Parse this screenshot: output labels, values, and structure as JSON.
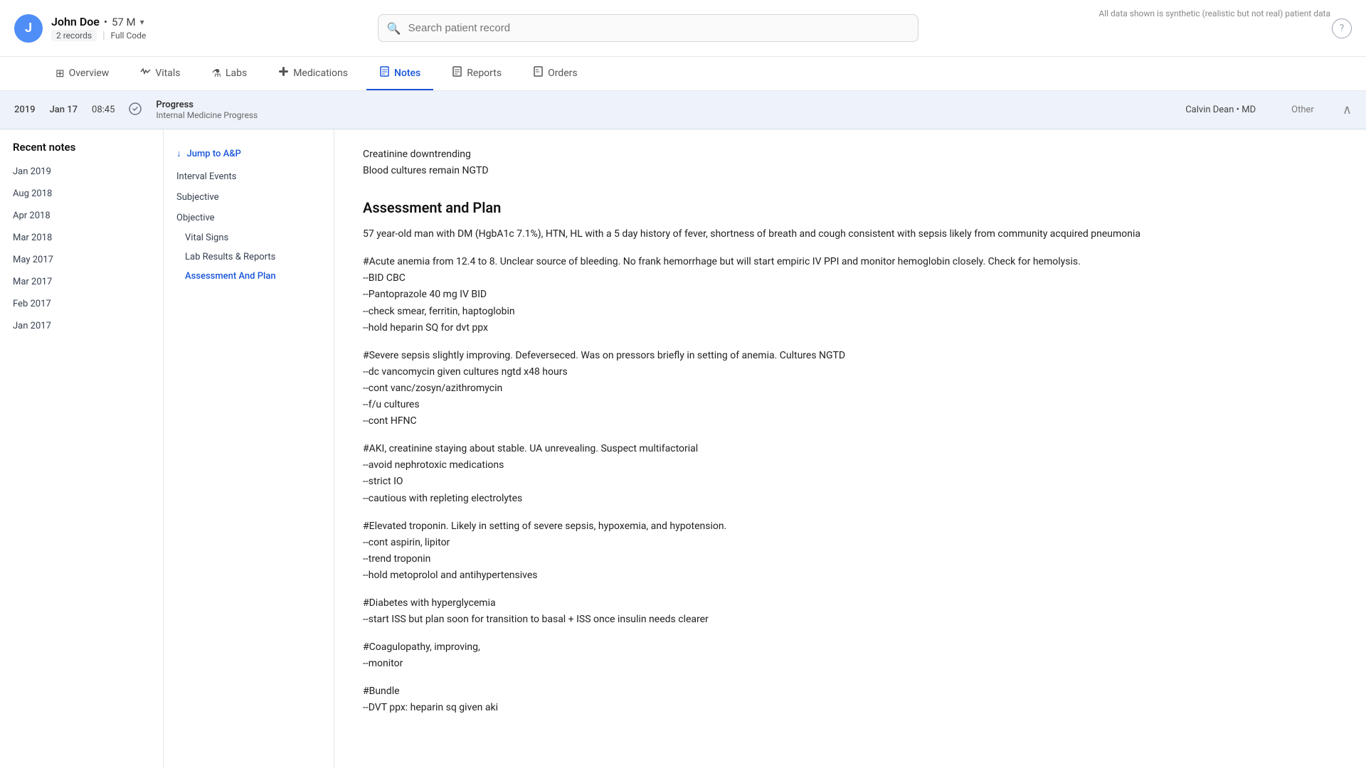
{
  "synthetic_note": "All data shown is synthetic (realistic but not real) patient data",
  "patient": {
    "name": "John Doe",
    "age_gender": "57 M",
    "records_count": "2 records",
    "code_status": "Full Code"
  },
  "search": {
    "placeholder": "Search patient record"
  },
  "nav_tabs": [
    {
      "id": "overview",
      "label": "Overview",
      "icon": "⊞"
    },
    {
      "id": "vitals",
      "label": "Vitals",
      "icon": "♥"
    },
    {
      "id": "labs",
      "label": "Labs",
      "icon": "⚗"
    },
    {
      "id": "medications",
      "label": "Medications",
      "icon": "💊"
    },
    {
      "id": "notes",
      "label": "Notes",
      "icon": "📝",
      "active": true
    },
    {
      "id": "reports",
      "label": "Reports",
      "icon": "📄"
    },
    {
      "id": "orders",
      "label": "Orders",
      "icon": "📋"
    }
  ],
  "note_header": {
    "year": "2019",
    "date": "Jan 17",
    "time": "08:45",
    "type": "Progress",
    "subtype": "Internal Medicine Progress",
    "doctor": "Calvin Dean • MD",
    "other": "Other"
  },
  "sidebar": {
    "title": "Recent notes",
    "items": [
      {
        "label": "Jan 2019"
      },
      {
        "label": "Aug 2018"
      },
      {
        "label": "Apr 2018"
      },
      {
        "label": "Mar 2018"
      },
      {
        "label": "May 2017"
      },
      {
        "label": "Mar 2017"
      },
      {
        "label": "Feb 2017"
      },
      {
        "label": "Jan 2017"
      }
    ]
  },
  "outline": {
    "jump_label": "Jump to A&P",
    "sections": [
      {
        "label": "Interval Events",
        "type": "section"
      },
      {
        "label": "Subjective",
        "type": "section"
      },
      {
        "label": "Objective",
        "type": "section"
      },
      {
        "label": "Vital Signs",
        "type": "sub"
      },
      {
        "label": "Lab Results & Reports",
        "type": "sub"
      },
      {
        "label": "Assessment And Plan",
        "type": "sub",
        "active": true
      }
    ]
  },
  "content": {
    "pre_text": "Creatinine downtrending\nBlood cultures remain NGTD",
    "assessment_title": "Assessment and Plan",
    "assessment_intro": "57 year-old man with DM (HgbA1c 7.1%), HTN, HL with a 5 day history of fever, shortness of breath and cough consistent with sepsis likely from community acquired pneumonia",
    "sections": [
      {
        "id": "anemia",
        "text": "#Acute anemia from 12.4 to 8. Unclear source of bleeding. No frank hemorrhage but will start empiric IV PPI and monitor hemoglobin closely. Check for hemolysis.\n--BID CBC\n--Pantoprazole 40 mg IV BID\n--check smear, ferritin, haptoglobin\n--hold heparin SQ for dvt ppx"
      },
      {
        "id": "sepsis",
        "text": "#Severe sepsis slightly improving. Defeverseced. Was on pressors briefly in setting of anemia. Cultures NGTD\n--dc vancomycin given cultures ngtd x48 hours\n--cont vanc/zosyn/azithromycin\n--f/u cultures\n--cont HFNC"
      },
      {
        "id": "aki",
        "text": "#AKI, creatinine staying about stable. UA unrevealing. Suspect multifactorial\n--avoid nephrotoxic medications\n--strict IO\n--cautious with repleting electrolytes"
      },
      {
        "id": "troponin",
        "text": "#Elevated troponin. Likely in setting of severe sepsis, hypoxemia, and hypotension.\n--cont aspirin, lipitor\n--trend troponin\n--hold metoprolol and antihypertensives"
      },
      {
        "id": "diabetes",
        "text": "#Diabetes with hyperglycemia\n--start ISS but plan soon for transition to basal + ISS once insulin needs clearer"
      },
      {
        "id": "coagulopathy",
        "text": "#Coagulopathy, improving,\n--monitor"
      },
      {
        "id": "bundle",
        "text": "#Bundle\n--DVT ppx: heparin sq given aki"
      }
    ]
  }
}
